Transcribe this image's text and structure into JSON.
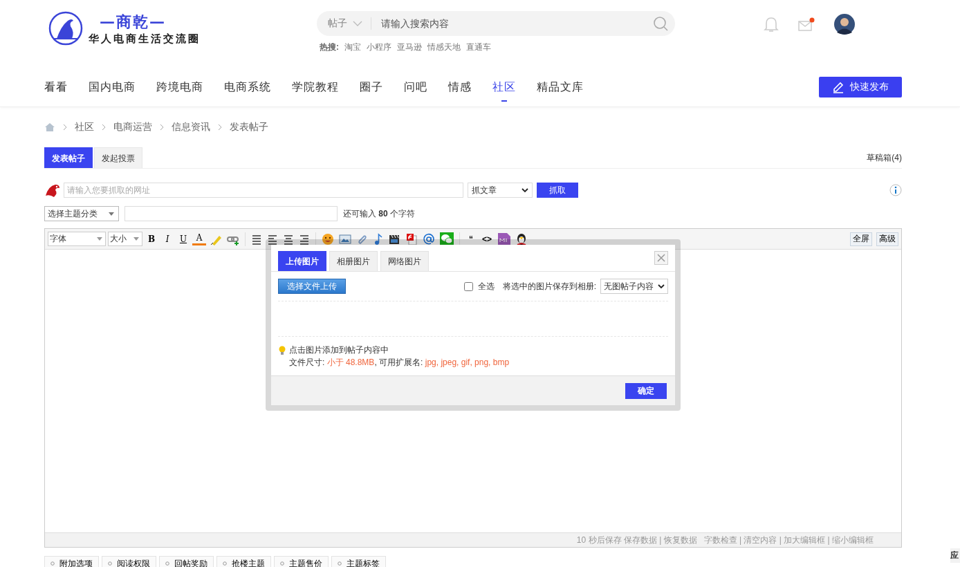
{
  "logo": {
    "title": "—商乾—",
    "subtitle": "华人电商生活交流圈"
  },
  "search": {
    "scope": "帖子",
    "placeholder": "请输入搜索内容",
    "hot_label": "热搜:",
    "hot": [
      "淘宝",
      "小程序",
      "亚马逊",
      "情感天地",
      "直通车"
    ]
  },
  "user": {
    "mail_unread": true
  },
  "nav": [
    {
      "label": "看看",
      "selected": false
    },
    {
      "label": "国内电商",
      "selected": false
    },
    {
      "label": "跨境电商",
      "selected": false
    },
    {
      "label": "电商系统",
      "selected": false
    },
    {
      "label": "学院教程",
      "selected": false
    },
    {
      "label": "圈子",
      "selected": false
    },
    {
      "label": "问吧",
      "selected": false
    },
    {
      "label": "情感",
      "selected": false
    },
    {
      "label": "社区",
      "selected": true
    },
    {
      "label": "精品文库",
      "selected": false
    }
  ],
  "publish_button": "快速发布",
  "breadcrumb": [
    "社区",
    "电商运营",
    "信息资讯",
    "发表帖子"
  ],
  "post_tabs": [
    {
      "label": "发表帖子",
      "selected": true
    },
    {
      "label": "发起投票",
      "selected": false
    }
  ],
  "drafts": "草稿箱(4)",
  "grab": {
    "placeholder": "请输入您要抓取的网址",
    "mode": "抓文章",
    "button": "抓取"
  },
  "topic": {
    "category": "选择主题分类",
    "remaining_prefix": "还可输入",
    "remaining_count": "80",
    "remaining_suffix": "个字符"
  },
  "editor": {
    "font": "字体",
    "size": "大小",
    "text_buttons": [
      "B",
      "I",
      "U",
      "A"
    ],
    "quote_buttons": [
      "“",
      "<>"
    ],
    "right_buttons": [
      "全屏",
      "高级"
    ],
    "status": "10 秒后保存 保存数据 | 恢复数据   字数检查 | 清空内容 | 加大编辑框 | 缩小编辑框"
  },
  "dialog": {
    "tabs": [
      {
        "label": "上传图片",
        "selected": true
      },
      {
        "label": "相册图片",
        "selected": false
      },
      {
        "label": "网络图片",
        "selected": false
      }
    ],
    "upload_button": "选择文件上传",
    "select_all": {
      "label": "全选",
      "checked": false
    },
    "save_label": "将选中的图片保存到相册:",
    "album": "无图帖子内容",
    "tip": "点击图片添加到帖子内容中",
    "size_label": "文件尺寸:",
    "size_value": "小于 48.8MB",
    "ext_label": ", 可用扩展名:",
    "ext_value": "jpg, jpeg, gif, png, bmp",
    "ok": "确定"
  },
  "options": [
    "附加选项",
    "阅读权限",
    "回帖奖励",
    "抢楼主题",
    "主题售价",
    "主题标签"
  ],
  "side_tab": "应"
}
